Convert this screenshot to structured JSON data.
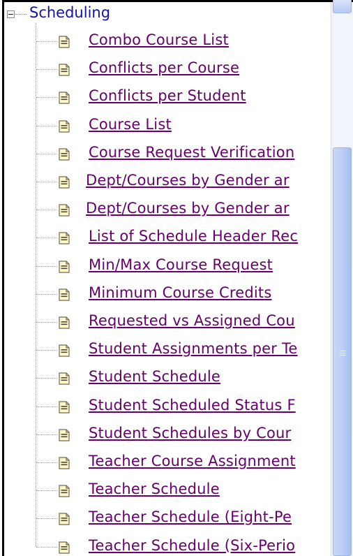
{
  "tree": {
    "root_label": "Scheduling",
    "items": [
      {
        "label": "Combo Course List"
      },
      {
        "label": "Conflicts per Course"
      },
      {
        "label": "Conflicts per Student"
      },
      {
        "label": "Course List"
      },
      {
        "label": "Course Request Verification"
      },
      {
        "label": "Dept/Courses by Gender ar"
      },
      {
        "label": "Dept/Courses by Gender ar"
      },
      {
        "label": "List of Schedule Header Rec"
      },
      {
        "label": "Min/Max Course Request"
      },
      {
        "label": "Minimum Course Credits"
      },
      {
        "label": "Requested vs Assigned Cou"
      },
      {
        "label": "Student Assignments per Te"
      },
      {
        "label": "Student Schedule"
      },
      {
        "label": "Student Scheduled Status F"
      },
      {
        "label": "Student Schedules by Cour"
      },
      {
        "label": "Teacher Course Assignment"
      },
      {
        "label": "Teacher Schedule"
      },
      {
        "label": "Teacher Schedule (Eight-Pe"
      },
      {
        "label": "Teacher Schedule (Six-Perio"
      }
    ]
  },
  "colors": {
    "root_text": "#1212a8",
    "link_text": "#66006b",
    "scrollbar_thumb": "#b6cbf5"
  },
  "icons": {
    "expander": "minus-box-icon",
    "item": "document-icon"
  }
}
